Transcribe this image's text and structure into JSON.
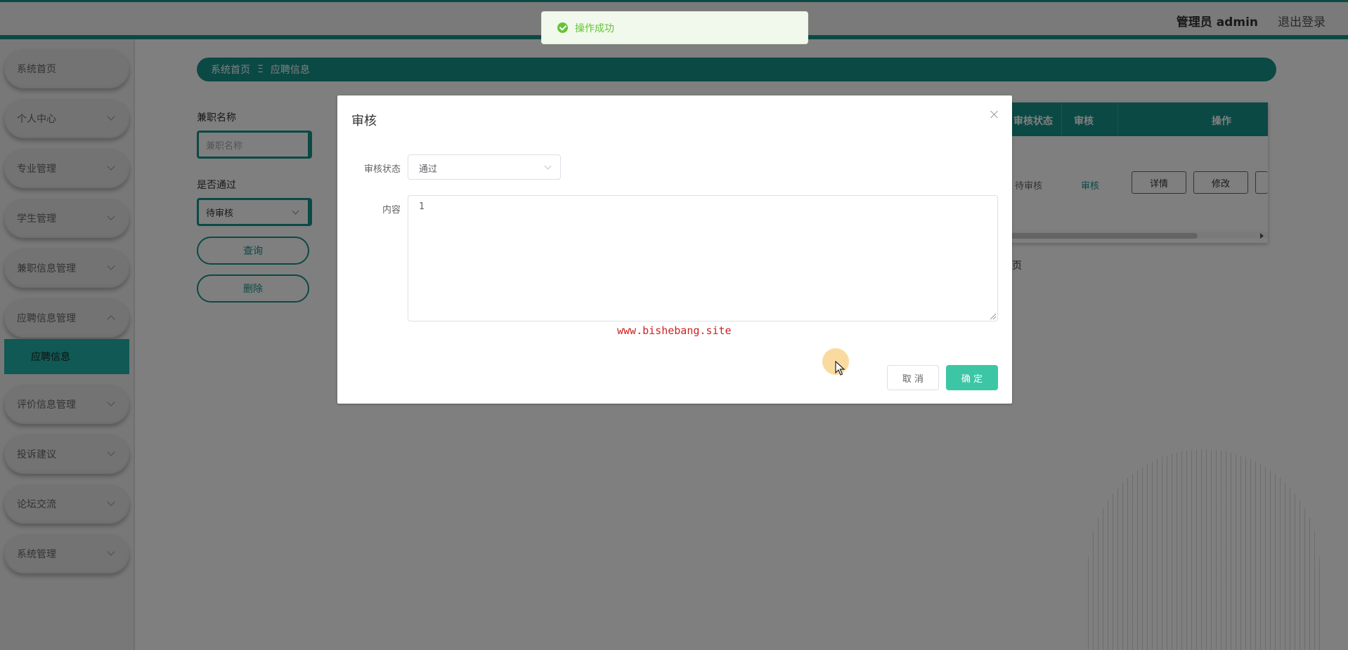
{
  "header": {
    "user_label": "管理员 admin",
    "logout_label": "退出登录"
  },
  "sidebar": {
    "items": [
      {
        "label": "系统首页",
        "has_arrow": false
      },
      {
        "label": "个人中心",
        "has_arrow": true
      },
      {
        "label": "专业管理",
        "has_arrow": true
      },
      {
        "label": "学生管理",
        "has_arrow": true
      },
      {
        "label": "兼职信息管理",
        "has_arrow": true
      },
      {
        "label": "应聘信息管理",
        "has_arrow": true,
        "expanded": true
      },
      {
        "label": "评价信息管理",
        "has_arrow": true
      },
      {
        "label": "投诉建议",
        "has_arrow": true
      },
      {
        "label": "论坛交流",
        "has_arrow": true
      },
      {
        "label": "系统管理",
        "has_arrow": true
      }
    ],
    "active_submenu": "应聘信息"
  },
  "breadcrumb": {
    "home": "系统首页",
    "separator": "Ξ",
    "current": "应聘信息"
  },
  "search": {
    "name_label": "兼职名称",
    "name_placeholder": "兼职名称",
    "pass_label": "是否通过",
    "pass_value": "待审核",
    "query_button": "查询",
    "delete_button": "删除"
  },
  "table": {
    "headers": {
      "review_status": "审核状态",
      "review": "审核",
      "actions": "操作"
    },
    "row": {
      "review_status": "待审核",
      "review_link": "审核",
      "detail_button": "详情",
      "edit_button": "修改"
    },
    "page_suffix": "页"
  },
  "toast": {
    "message": "操作成功"
  },
  "dialog": {
    "title": "审核",
    "status_label": "审核状态",
    "status_value": "通过",
    "content_label": "内容",
    "content_value": "1",
    "watermark": "www.bishebang.site",
    "cancel_button": "取 消",
    "confirm_button": "确 定"
  },
  "colors": {
    "primary": "#16928a",
    "confirm": "#3cc6a6",
    "success": "#67c23a"
  }
}
